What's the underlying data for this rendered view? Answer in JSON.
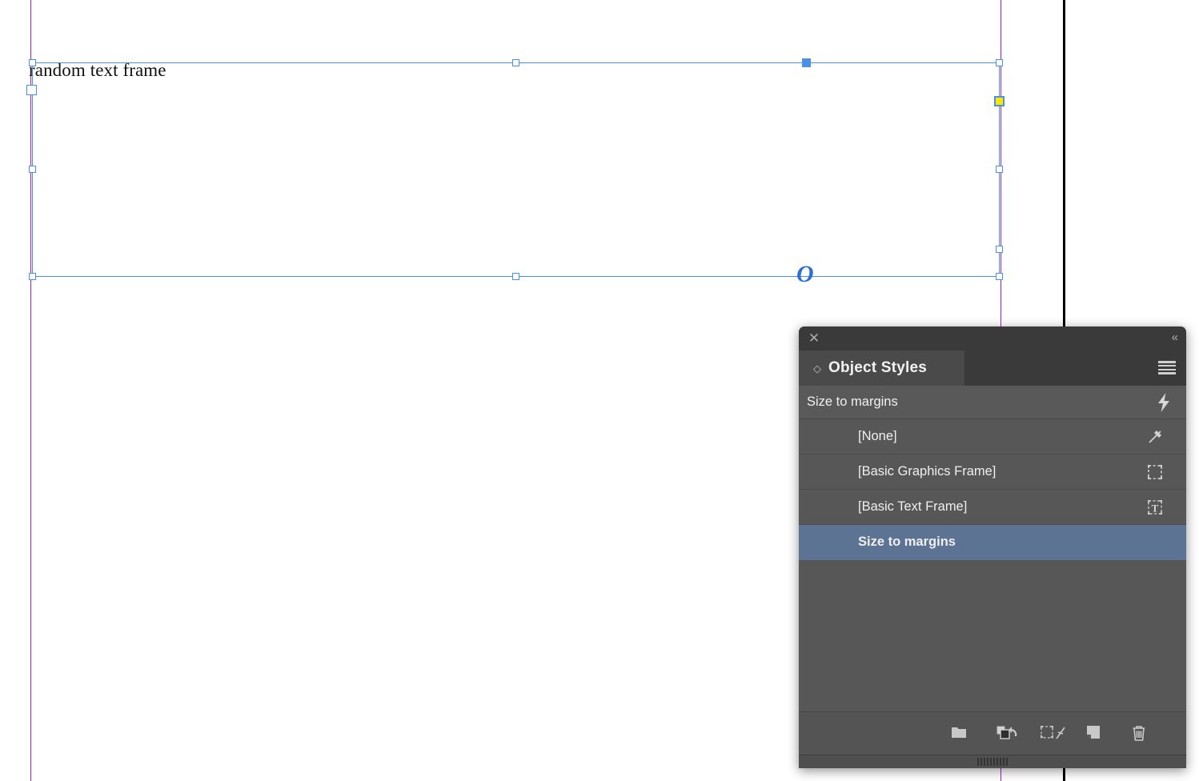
{
  "canvas": {
    "text_frame": {
      "content": "random text frame",
      "outport_glyph": "O"
    }
  },
  "panel": {
    "titlebar": {
      "close_label": "✕",
      "collapse_label": "«"
    },
    "tab": {
      "diamond": "◇",
      "label": "Object Styles"
    },
    "menu_button_name": "panel-menu",
    "current_style": {
      "name": "Size to margins",
      "quick_apply_icon": "lightning-icon"
    },
    "styles": [
      {
        "label": "[None]",
        "icon": "none-style-icon",
        "selected": false
      },
      {
        "label": "[Basic Graphics Frame]",
        "icon": "graphics-frame-icon",
        "selected": false
      },
      {
        "label": "[Basic Text Frame]",
        "icon": "text-frame-icon",
        "selected": false
      },
      {
        "label": "Size to margins",
        "icon": "",
        "selected": true
      }
    ],
    "footer": [
      {
        "name": "new-style-group-button",
        "icon": "folder-icon"
      },
      {
        "name": "clear-overrides-button",
        "icon": "clear-overrides-icon"
      },
      {
        "name": "clear-attributes-button",
        "icon": "clear-attributes-icon"
      },
      {
        "name": "new-style-button",
        "icon": "new-page-icon"
      },
      {
        "name": "delete-style-button",
        "icon": "trash-icon"
      }
    ]
  },
  "colors": {
    "selection_blue": "#4a90e8",
    "selected_row": "#5d7394",
    "panel_bg": "#535353",
    "margin_guide": "#a21fd6",
    "corner_handle_yellow": "#ffe500"
  }
}
